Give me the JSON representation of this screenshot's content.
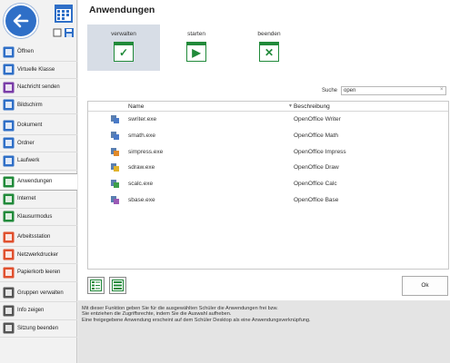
{
  "sidebar": {
    "items": [
      {
        "label": "Öffnen",
        "icon": "folder-open-icon",
        "color": "#2f6fc7"
      },
      {
        "label": "Virtuelle Klasse",
        "icon": "virtual-class-icon",
        "color": "#2f6fc7"
      },
      {
        "label": "Nachricht senden",
        "icon": "message-icon",
        "color": "#7a3da8"
      },
      {
        "label": "Bildschirm",
        "icon": "monitor-icon",
        "color": "#2f6fc7"
      },
      {
        "label": "Dokument",
        "icon": "document-icon",
        "color": "#2f6fc7"
      },
      {
        "label": "Ordner",
        "icon": "folder-icon",
        "color": "#2f6fc7"
      },
      {
        "label": "Laufwerk",
        "icon": "drive-icon",
        "color": "#2f6fc7"
      },
      {
        "label": "Anwendungen",
        "icon": "applications-icon",
        "color": "#218a3a"
      },
      {
        "label": "Internet",
        "icon": "internet-icon",
        "color": "#218a3a"
      },
      {
        "label": "Klausurmodus",
        "icon": "exam-mode-icon",
        "color": "#218a3a"
      },
      {
        "label": "Arbeitsstation",
        "icon": "workstation-icon",
        "color": "#e0502e"
      },
      {
        "label": "Netzwerkdrucker",
        "icon": "printer-icon",
        "color": "#e0502e"
      },
      {
        "label": "Papierkorb leeren",
        "icon": "trash-icon",
        "color": "#e0502e"
      },
      {
        "label": "Gruppen verwalten",
        "icon": "groups-icon",
        "color": "#555555"
      },
      {
        "label": "Info zeigen",
        "icon": "info-icon",
        "color": "#555555"
      },
      {
        "label": "Sitzung beenden",
        "icon": "logout-icon",
        "color": "#555555"
      }
    ]
  },
  "main": {
    "title": "Anwendungen",
    "actions": [
      {
        "label": "verwalten",
        "glyph": "✓"
      },
      {
        "label": "starten",
        "glyph": "▶"
      },
      {
        "label": "beenden",
        "glyph": "✕"
      }
    ],
    "search": {
      "label": "Suche",
      "value": "open"
    },
    "table": {
      "columns": [
        "Name",
        "Beschreibung"
      ],
      "rows": [
        {
          "name": "swriter.exe",
          "desc": "OpenOffice Writer",
          "color": "#4a7ac7"
        },
        {
          "name": "smath.exe",
          "desc": "OpenOffice Math",
          "color": "#4a7ac7"
        },
        {
          "name": "simpress.exe",
          "desc": "OpenOffice Impress",
          "color": "#e08a2a"
        },
        {
          "name": "sdraw.exe",
          "desc": "OpenOffice Draw",
          "color": "#e0b22a"
        },
        {
          "name": "scalc.exe",
          "desc": "OpenOffice Calc",
          "color": "#3ea04a"
        },
        {
          "name": "sbase.exe",
          "desc": "OpenOffice Base",
          "color": "#9a5ab5"
        }
      ]
    },
    "ok_label": "Ok",
    "info_lines": [
      "Mit dieser Funktion geben Sie für die ausgewählten Schüler die Anwendungen frei bzw.",
      "Sie entziehen die Zugriffsrechte, indem Sie die Auswahl aufheben.",
      "Eine freigegebene Anwendung erscheint auf dem Schüler Desktop als eine Anwendungsverknüpfung."
    ]
  },
  "colors": {
    "accent": "#2f6fc7",
    "green": "#218a3a",
    "selected": "#d7dde6"
  }
}
